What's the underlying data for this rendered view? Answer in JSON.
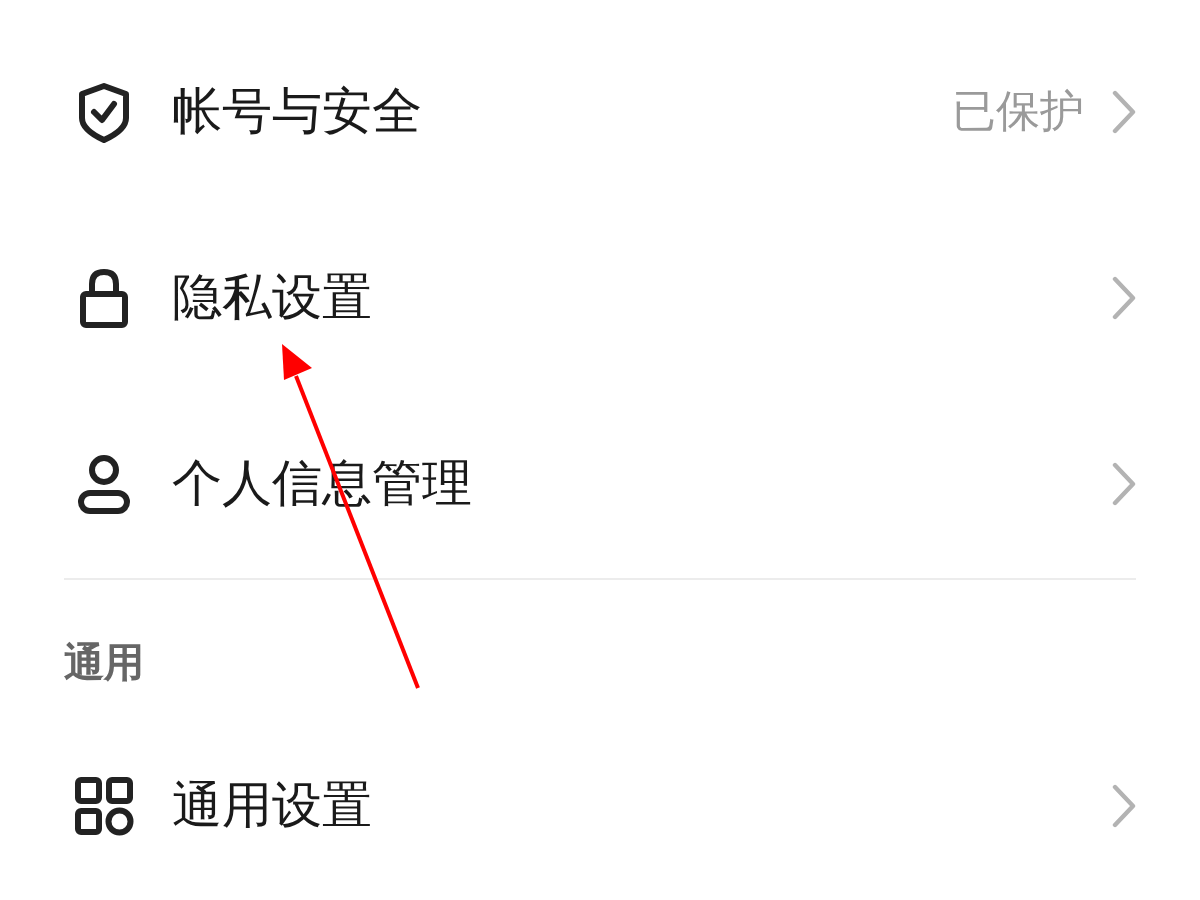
{
  "sections": [
    {
      "items": [
        {
          "label": "帐号与安全",
          "value": "已保护"
        },
        {
          "label": "隐私设置"
        },
        {
          "label": "个人信息管理"
        }
      ]
    },
    {
      "title": "通用",
      "items": [
        {
          "label": "通用设置"
        }
      ]
    }
  ],
  "annotation": {
    "kind": "arrow"
  }
}
